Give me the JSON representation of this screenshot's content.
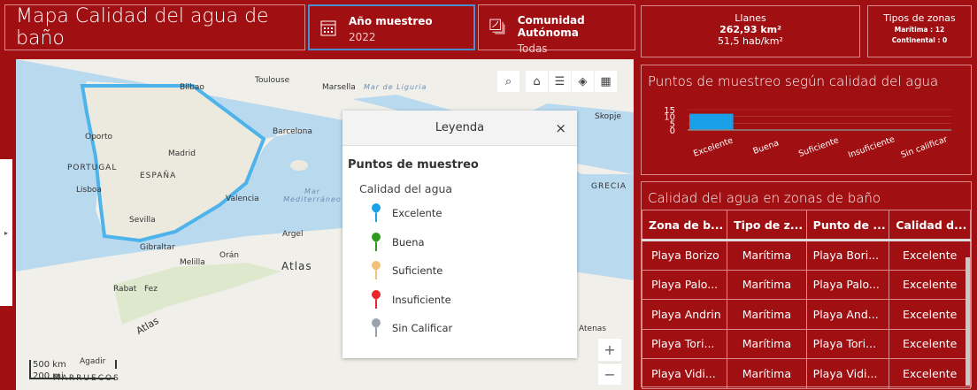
{
  "header": {
    "title": "Mapa Calidad del agua de baño",
    "year": {
      "label": "Año muestreo",
      "value": "2022",
      "icon": "calendar-icon"
    },
    "ccaa": {
      "label": "Comunidad Autónoma",
      "value": "Todas",
      "icon": "map-layers-icon"
    }
  },
  "map": {
    "labels": [
      "Toulouse",
      "Marsella",
      "Mar de Liguria",
      "Bilbao",
      "Oporto",
      "PORTUGAL",
      "ESPAÑA",
      "Madrid",
      "Lisboa",
      "Valencia",
      "Barcelona",
      "Mar Mediterráneo",
      "Sevilla",
      "Gibraltar",
      "Argel",
      "Melilla",
      "Orán",
      "Atlas",
      "Rabat",
      "Fez",
      "Atlas",
      "Agadir",
      "MARRUECOS",
      "Skopje",
      "GRECIA",
      "Atenas"
    ],
    "scale": {
      "km": "500 km",
      "mi": "200 mi"
    },
    "zoom_in": "+",
    "zoom_out": "−"
  },
  "legend": {
    "title": "Leyenda",
    "close": "×",
    "section": "Puntos de muestreo",
    "field": "Calidad del agua",
    "items": [
      {
        "label": "Excelente",
        "color": "#1aa0e8"
      },
      {
        "label": "Buena",
        "color": "#2e9b1e"
      },
      {
        "label": "Suficiente",
        "color": "#f2c27a"
      },
      {
        "label": "Insuficiente",
        "color": "#e8262b"
      },
      {
        "label": "Sin Calificar",
        "color": "#9aa3ad"
      }
    ]
  },
  "info": {
    "place": "Llanes",
    "area": "262,93 km²",
    "density": "51,5 hab/km²"
  },
  "tipos": {
    "title": "Tipos de zonas",
    "maritima": "Marítima : 12",
    "continental": "Continental : 0"
  },
  "chart_data": {
    "type": "bar",
    "title": "Puntos de muestreo según calidad del agua",
    "categories": [
      "Excelente",
      "Buena",
      "Suficiente",
      "Insuficiente",
      "Sin calificar"
    ],
    "values": [
      12,
      0.3,
      0,
      0,
      0
    ],
    "colors": [
      "#1aa0e8",
      "#4a9b1e",
      "#f2c27a",
      "#e8262b",
      "#9aa3ad"
    ],
    "yticks": [
      "15",
      "10",
      "5",
      "0"
    ],
    "ylim": [
      0,
      15
    ]
  },
  "table": {
    "title": "Calidad del agua en zonas de baño",
    "headers": [
      "Zona de b...",
      "Tipo de z...",
      "Punto de ...",
      "Calidad d..."
    ],
    "rows": [
      [
        "Playa Borizo",
        "Marítima",
        "Playa Bori...",
        "Excelente"
      ],
      [
        "Playa Palo...",
        "Marítima",
        "Playa Palo...",
        "Excelente"
      ],
      [
        "Playa Andrin",
        "Marítima",
        "Playa And...",
        "Excelente"
      ],
      [
        "Playa Tori...",
        "Marítima",
        "Playa Tori...",
        "Excelente"
      ],
      [
        "Playa Vidi...",
        "Marítima",
        "Playa Vidi...",
        "Excelente"
      ]
    ]
  }
}
